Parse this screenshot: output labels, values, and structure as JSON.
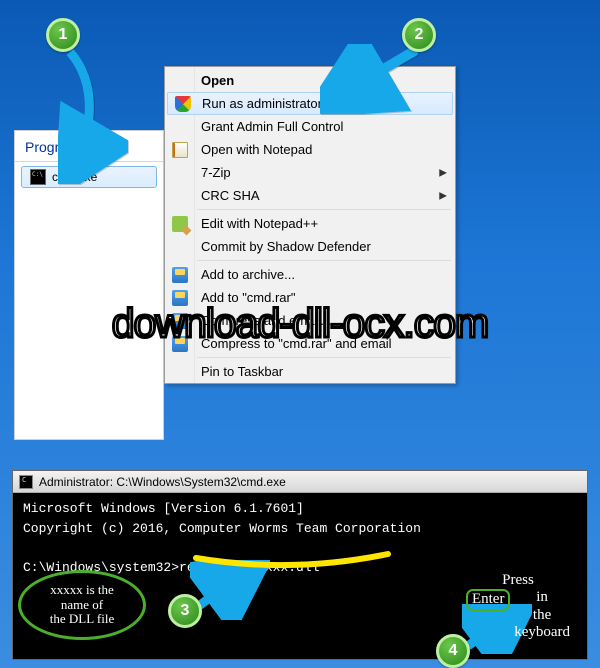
{
  "badges": {
    "b1": "1",
    "b2": "2",
    "b3": "3",
    "b4": "4"
  },
  "programs": {
    "header": "Programs (1)",
    "item": "cmd.exe"
  },
  "ctx": {
    "title": "Open",
    "run_admin": "Run as administrator",
    "grant_admin": "Grant Admin Full Control",
    "open_notepad": "Open with Notepad",
    "sevenzip": "7-Zip",
    "crcsha": "CRC SHA",
    "edit_npp": "Edit with Notepad++",
    "commit_shadow": "Commit by Shadow Defender",
    "add_archive": "Add to archive...",
    "add_cmdrar": "Add to \"cmd.rar\"",
    "compress_email": "Compress and email...",
    "compress_cmdrar_email": "Compress to \"cmd.rar\" and email",
    "pin_taskbar": "Pin to Taskbar"
  },
  "watermark": "download-dll-ocx.com",
  "cmd": {
    "title": "Administrator: C:\\Windows\\System32\\cmd.exe",
    "line1": "Microsoft Windows [Version 6.1.7601]",
    "line2": "Copyright (c) 2016, Computer Worms Team Corporation",
    "prompt": "C:\\Windows\\system32>",
    "command": "regsvr32 xxxxx.dll"
  },
  "callouts": {
    "dllname": "xxxxx is the\nname of\nthe DLL file",
    "press": "Press",
    "enter": "Enter",
    "in_the_kb": "in\nthe\nkeyboard"
  }
}
